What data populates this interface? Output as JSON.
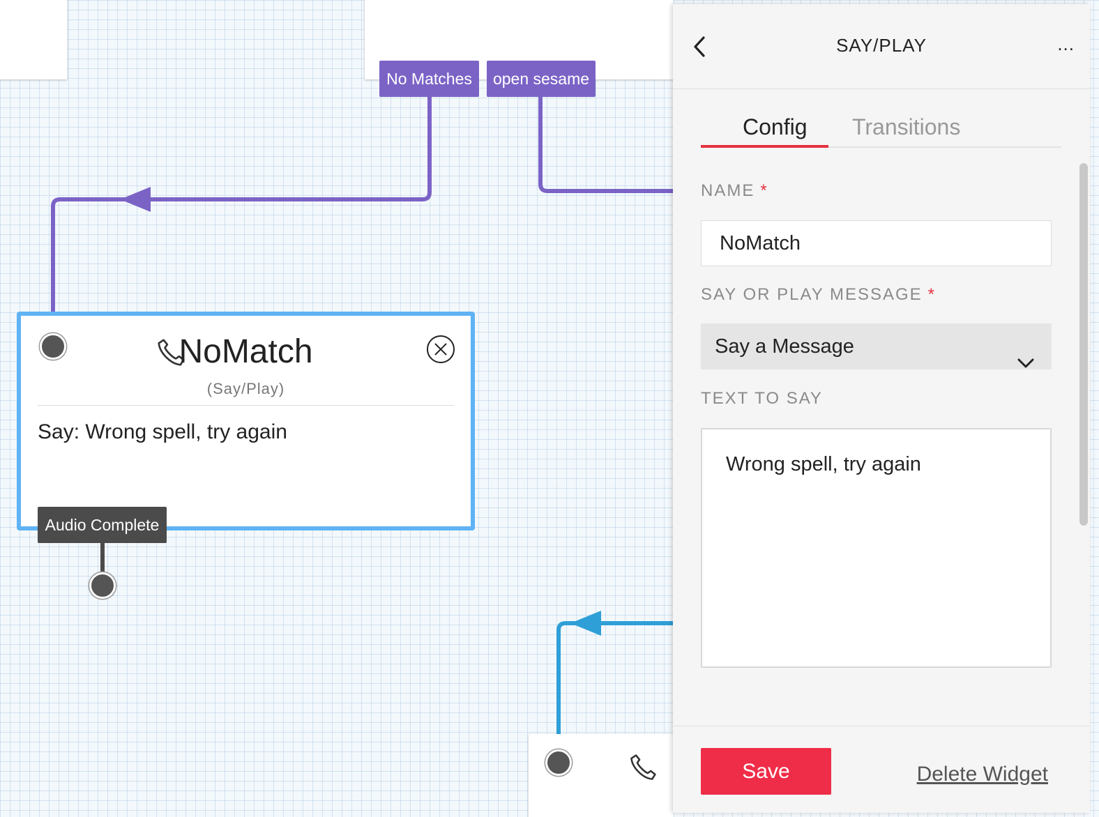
{
  "canvas": {
    "transitions": {
      "no_matches": "No Matches",
      "open_sesame": "open sesame",
      "audio_complete": "Audio Complete"
    },
    "widget": {
      "title": "NoMatch",
      "subtitle": "(Say/Play)",
      "body": "Say: Wrong spell, try again",
      "icon": "phone-icon"
    },
    "colors": {
      "transition_purple": "#7b63c6",
      "wire_blue": "#2f9fd8",
      "widget_border": "#5fb3f4"
    }
  },
  "panel": {
    "title": "SAY/PLAY",
    "more": "...",
    "tabs": [
      {
        "label": "Config",
        "active": true
      },
      {
        "label": "Transitions",
        "active": false
      }
    ],
    "fields": {
      "name_label": "NAME",
      "name_value": "NoMatch",
      "message_label": "SAY OR PLAY MESSAGE",
      "message_value": "Say a Message",
      "text_label": "TEXT TO SAY",
      "text_value": "Wrong spell, try again",
      "required_mark": "*"
    },
    "footer": {
      "save_label": "Save",
      "delete_label": "Delete Widget"
    },
    "colors": {
      "accent_red": "#ef2d48"
    }
  }
}
